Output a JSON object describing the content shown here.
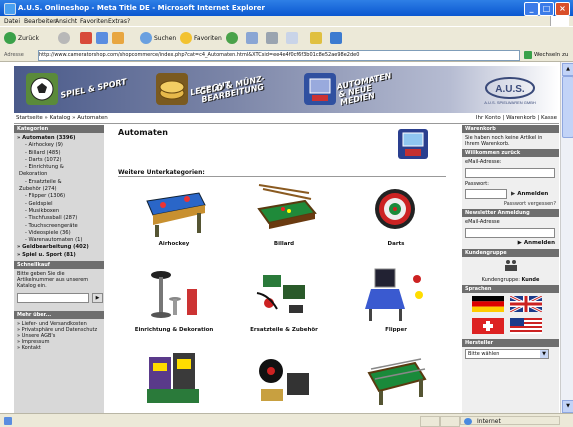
{
  "window": {
    "title": "A.U.S. Onlineshop - Meta Title DE - Microsoft Internet Explorer"
  },
  "menu": [
    "Datei",
    "Bearbeiten",
    "Ansicht",
    "Favoriten",
    "Extras",
    "?"
  ],
  "toolbar": {
    "back": "Zurück",
    "search": "Suchen",
    "favorites": "Favoriten"
  },
  "address": {
    "label": "Adresse",
    "url": "http://www.cameratorshop.com/shopcommerce/index.php?cat=c4_Automaten.html&XTCsid=ee4e4f0cf6f3b01c8e52ae98e2de0",
    "go": "Wechseln zu"
  },
  "banner": {
    "nav": [
      "SPIEL & SPORT",
      "LEERGUT",
      "GELD & MÜNZ-BEARBEITUNG",
      "AUTOMATEN & NEUE MEDIEN"
    ],
    "logo_text": "A.U.S.",
    "logo_sub": "A.U.S. SPIELWAREN GMBH"
  },
  "breadcrumb": {
    "path": "Startseite » Katalog » Automaten",
    "right": "Ihr Konto | Warenkorb | Kasse"
  },
  "left": {
    "categories_title": "Kategorien",
    "categories": [
      {
        "label": "Automaten (3396)",
        "level": 0,
        "bold": true,
        "bullet": "»"
      },
      {
        "label": "Airhockey (9)",
        "level": 1
      },
      {
        "label": "Billard (485)",
        "level": 1
      },
      {
        "label": "Darts (1072)",
        "level": 1
      },
      {
        "label": "Einrichtung &",
        "level": 1
      },
      {
        "label": "Dekoration",
        "level": 2
      },
      {
        "label": "Ersatzteile &",
        "level": 1
      },
      {
        "label": "Zubehör (274)",
        "level": 2
      },
      {
        "label": "Flipper (1306)",
        "level": 1
      },
      {
        "label": "Geldspiel",
        "level": 1
      },
      {
        "label": "Musikboxen",
        "level": 1
      },
      {
        "label": "Tischfussball (287)",
        "level": 1
      },
      {
        "label": "Touchscreengeräte",
        "level": 1
      },
      {
        "label": "Videospiele (36)",
        "level": 1
      },
      {
        "label": "Warenautomaten (1)",
        "level": 1
      },
      {
        "label": "Geldbearbeitung (402)",
        "level": 0,
        "bold": true,
        "bullet": "»"
      },
      {
        "label": "Spiel u. Sport (81)",
        "level": 0,
        "bold": true,
        "bullet": "»"
      }
    ],
    "quick_title": "Schnellkauf",
    "quick_text": "Bitte geben Sie die Artikelnummer aus unserem Katalog ein.",
    "info_title": "Mehr über...",
    "info_items": [
      "Liefer- und Versandkosten",
      "Privatsphäre und Datenschutz",
      "Unsere AGB's",
      "Impressum",
      "Kontakt"
    ]
  },
  "main": {
    "title": "Automaten",
    "subheading": "Weitere Unterkategorien:",
    "tiles": [
      {
        "label": "Airhockey",
        "icon": "airhockey-table"
      },
      {
        "label": "Billard",
        "icon": "billiard-table"
      },
      {
        "label": "Darts",
        "icon": "dartboard"
      },
      {
        "label": "Einrichtung & Dekoration",
        "icon": "bar-stool"
      },
      {
        "label": "Ersatzteile & Zubehör",
        "icon": "spare-parts"
      },
      {
        "label": "Flipper",
        "icon": "pinball-machine"
      },
      {
        "label": "",
        "icon": "slot-machines"
      },
      {
        "label": "",
        "icon": "jukebox-parts"
      },
      {
        "label": "",
        "icon": "foosball-table"
      }
    ]
  },
  "right": {
    "cart_title": "Warenkorb",
    "cart_text": "Sie haben noch keine Artikel in Ihrem Warenkorb.",
    "welcome_title": "Willkommen zurück",
    "email_label": "eMail-Adresse:",
    "password_label": "Passwort:",
    "login_button": "Anmelden",
    "forgot": "Passwort vergessen?",
    "newsletter_title": "Newsletter Anmeldung",
    "newsletter_email": "eMail-Adresse",
    "newsletter_button": "Anmelden",
    "customer_group_title": "Kundengruppe",
    "customer_group_label": "Kundengruppe:",
    "customer_group_value": "Kunde",
    "languages_title": "Sprachen",
    "manufacturer_title": "Hersteller",
    "manufacturer_select": "Bitte wählen"
  },
  "status": {
    "zone": "Internet"
  }
}
